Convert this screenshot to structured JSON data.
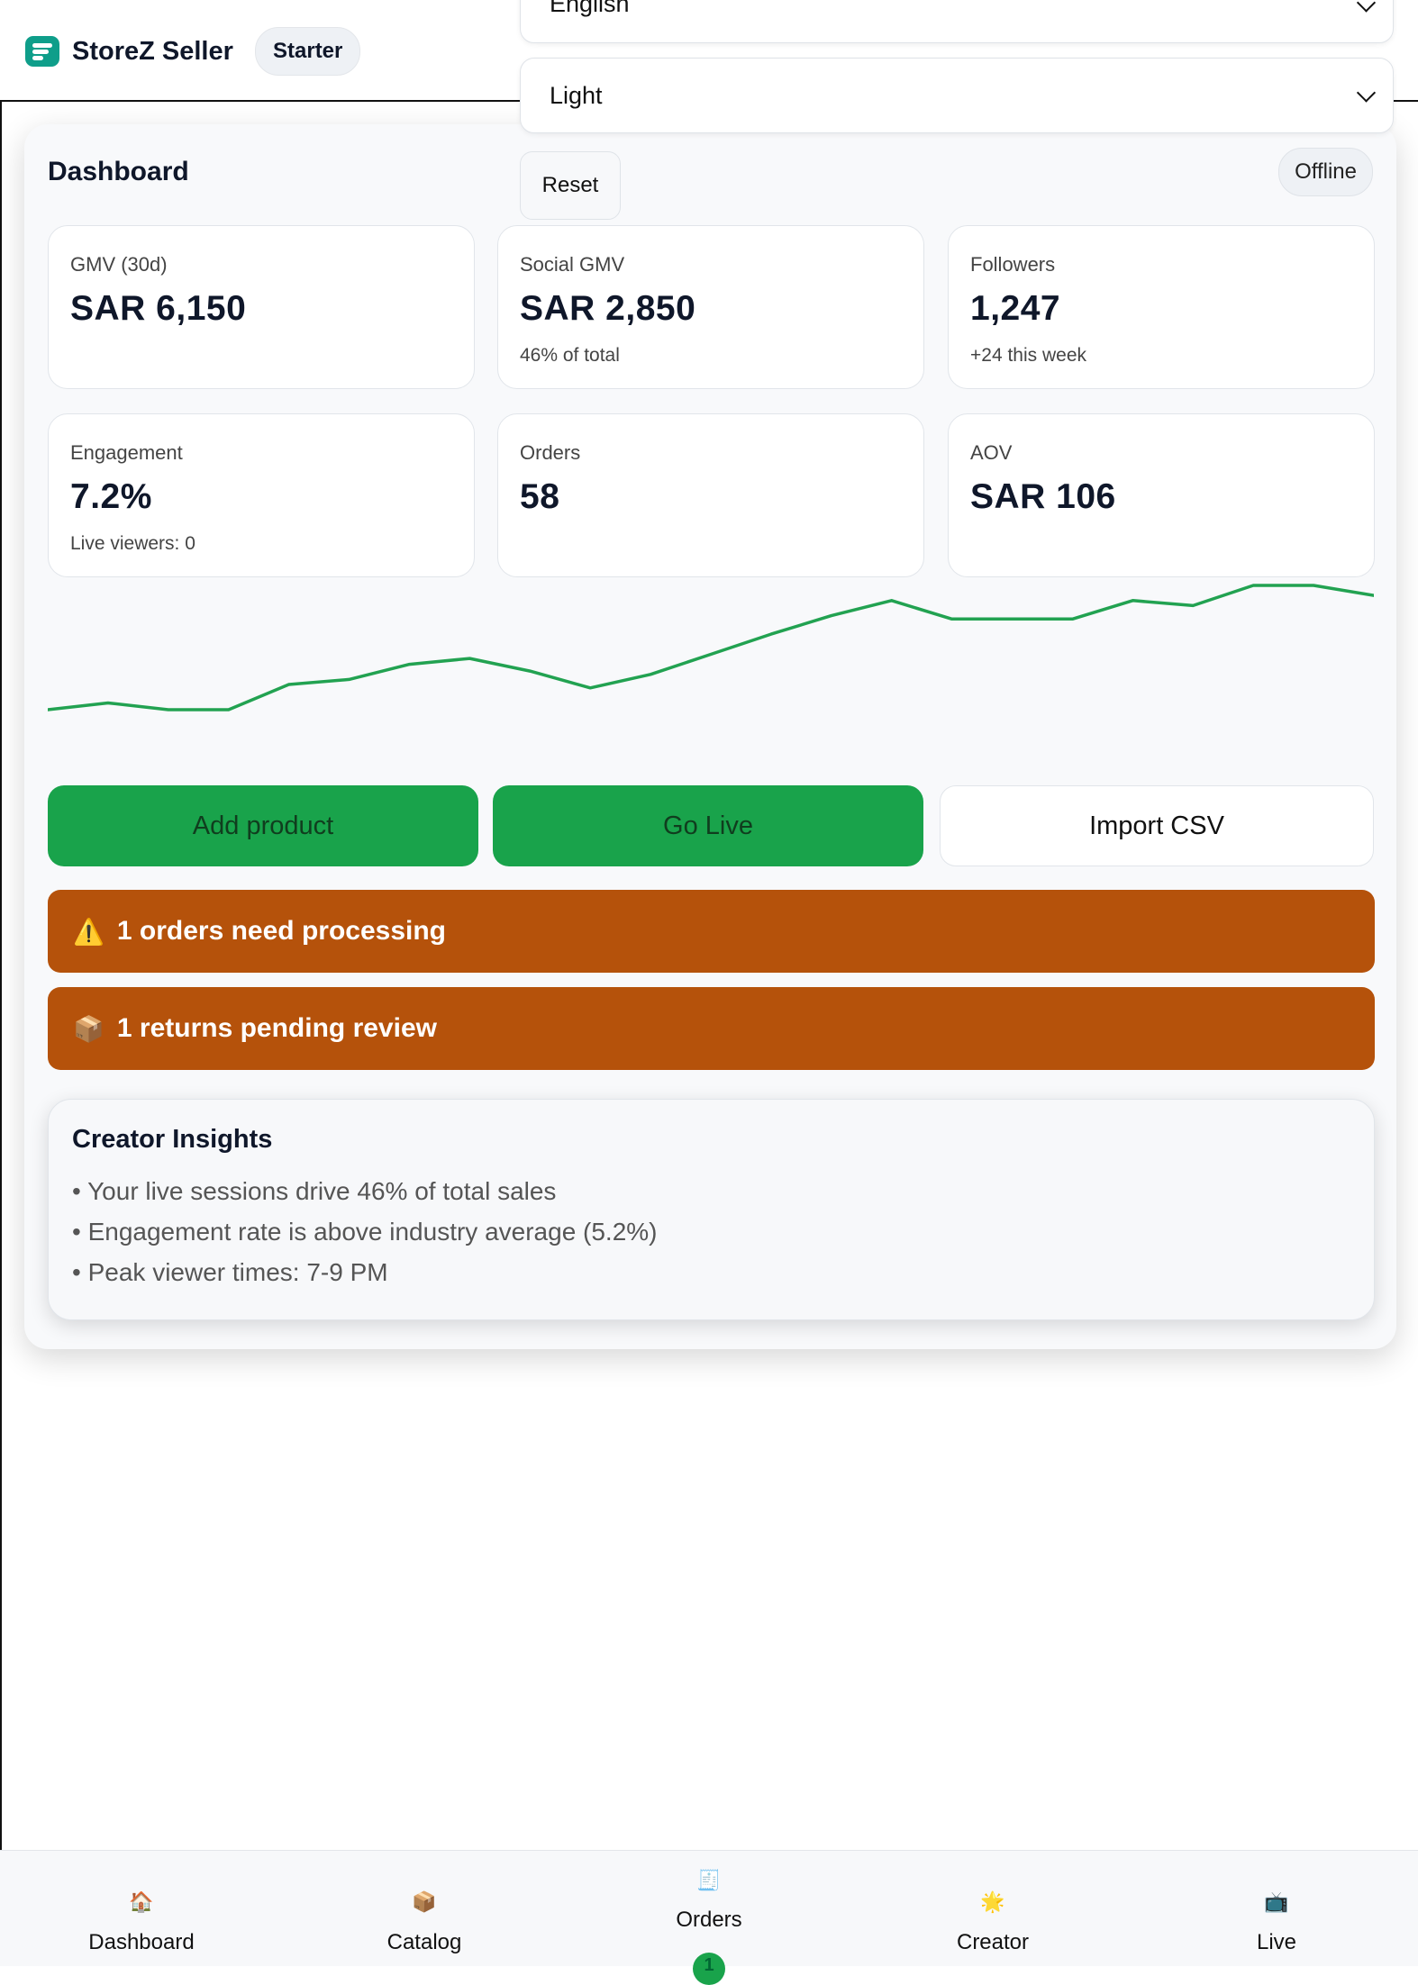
{
  "header": {
    "app_name": "StoreZ Seller",
    "plan": "Starter",
    "language_select": {
      "value": "English"
    },
    "theme_select": {
      "value": "Light"
    },
    "reset_label": "Reset"
  },
  "dashboard": {
    "title": "Dashboard",
    "status": "Offline",
    "kpis": [
      {
        "label": "GMV (30d)",
        "value": "SAR 6,150",
        "sub": ""
      },
      {
        "label": "Social GMV",
        "value": "SAR 2,850",
        "sub": "46% of total"
      },
      {
        "label": "Followers",
        "value": "1,247",
        "sub": "+24 this week"
      },
      {
        "label": "Engagement",
        "value": "7.2%",
        "sub": "Live viewers: 0"
      },
      {
        "label": "Orders",
        "value": "58",
        "sub": ""
      },
      {
        "label": "AOV",
        "value": "SAR 106",
        "sub": ""
      }
    ],
    "sparkline": {
      "color": "#22a251",
      "values": [
        6,
        14,
        6,
        6,
        36,
        42,
        60,
        67,
        52,
        32,
        48,
        72,
        96,
        118,
        136,
        114,
        114,
        114,
        136,
        130,
        154,
        154,
        142
      ]
    },
    "actions": {
      "add_product": "Add product",
      "go_live": "Go Live",
      "import_csv": "Import CSV"
    },
    "alerts": [
      {
        "icon": "⚠️",
        "text": "1 orders need processing"
      },
      {
        "icon": "📦",
        "text": "1 returns pending review"
      }
    ],
    "insights": {
      "title": "Creator Insights",
      "items": [
        "Your live sessions drive 46% of total sales",
        "Engagement rate is above industry average (5.2%)",
        "Peak viewer times: 7-9 PM"
      ]
    }
  },
  "bottom_nav": {
    "items": [
      {
        "label": "Dashboard",
        "icon": "🏠"
      },
      {
        "label": "Catalog",
        "icon": "📦"
      },
      {
        "label": "Orders",
        "icon": "🧾",
        "badge": "1"
      },
      {
        "label": "Creator",
        "icon": "🌟"
      },
      {
        "label": "Live",
        "icon": "📺"
      }
    ]
  },
  "colors": {
    "accent_green": "#19a34b",
    "alert_orange": "#b5520b",
    "brand_teal": "#0f9e8a"
  }
}
